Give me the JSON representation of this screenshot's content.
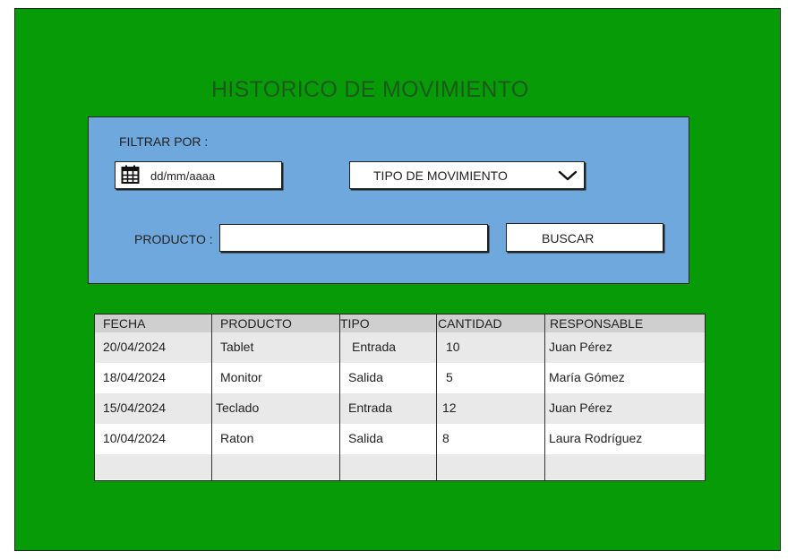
{
  "title": "HISTORICO DE MOVIMIENTO",
  "filters": {
    "label": "FILTRAR POR :",
    "date_value": "dd/mm/aaaa",
    "date_icon": "calendar-icon",
    "type_value": "TIPO DE MOVIMIENTO",
    "type_icon": "chevron-down-icon",
    "product_label": "PRODUCTO :",
    "product_value": "",
    "search_label": "BUSCAR"
  },
  "table": {
    "headers": [
      "FECHA",
      "PRODUCTO",
      "TIPO",
      "CANTIDAD",
      "RESPONSABLE"
    ],
    "rows": [
      [
        "20/04/2024",
        "Tablet",
        "Entrada",
        "10",
        "Juan Pérez"
      ],
      [
        "18/04/2024",
        "Monitor",
        "Salida",
        "5",
        "María Gómez"
      ],
      [
        "15/04/2024",
        "Teclado",
        "Entrada",
        "12",
        "Juan Pérez"
      ],
      [
        "10/04/2024",
        "Raton",
        "Salida",
        "8",
        "Laura Rodríguez"
      ]
    ]
  },
  "colors": {
    "background": "#079b07",
    "panel": "#6fa8dc",
    "title": "#1c5a1c",
    "table_header": "#cfcfcf",
    "row_shade": "#e9e9e9"
  }
}
